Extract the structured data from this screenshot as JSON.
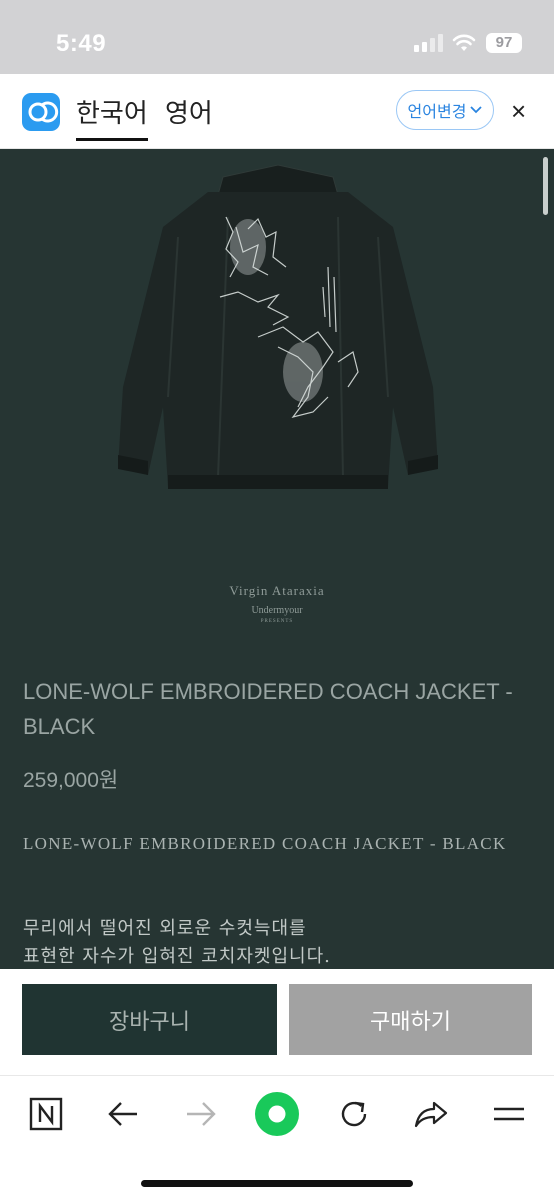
{
  "status_bar": {
    "time": "5:49",
    "battery": "97"
  },
  "translate_bar": {
    "languages": [
      "한국어",
      "영어"
    ],
    "change_label": "언어변경",
    "close_label": "×"
  },
  "product": {
    "brand": {
      "name": "Virgin Ataraxia",
      "sub": "Undermyour",
      "tiny": "PRESENTS"
    },
    "title": "LONE-WOLF EMBROIDERED COACH JACKET  - BLACK",
    "price": "259,000원",
    "description_en": "LONE-WOLF EMBROIDERED COACH JACKET  - BLACK",
    "description_kr_lines": [
      "무리에서 떨어진 외로운 수컷늑대를",
      "표현한 자수가 입혀진 코치자켓입니다."
    ]
  },
  "actions": {
    "cart_label": "장바구니",
    "buy_label": "구매하기"
  },
  "toolbar": {
    "icons": [
      "naver-home-icon",
      "back-arrow-icon",
      "forward-arrow-icon",
      "green-dot-icon",
      "refresh-icon",
      "share-icon",
      "menu-icon"
    ],
    "accent_color": "#19c95a"
  },
  "colors": {
    "content_bg": "#263533",
    "cart_button": "#203432",
    "buy_button": "#a2a2a2",
    "translate_accent": "#2b9bf0"
  }
}
